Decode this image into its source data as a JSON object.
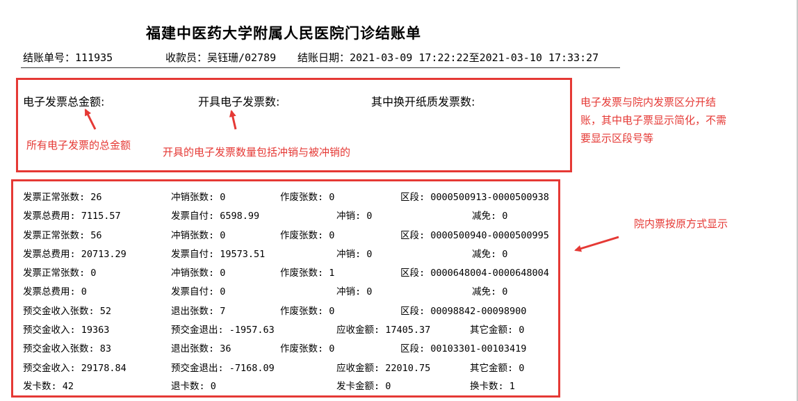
{
  "title": "福建中医药大学附属人民医院门诊结账单",
  "header": {
    "bill_no": "结账单号：111935",
    "cashier": "收款员：吴钰珊/02789",
    "date_range": "结账日期：2021-03-09 17:22:22至2021-03-10 17:33:27"
  },
  "electronic": {
    "total_amount_label": "电子发票总金额:",
    "count_label": "开具电子发票数:",
    "paper_label": "其中换开纸质发票数:"
  },
  "annotations": {
    "total_note": "所有电子发票的总金额",
    "count_note": "开具的电子发票数量包括冲销与被冲销的",
    "side_note_lines": [
      "电子发票与院内发票区分开结",
      "账，其中电子票显示简化，不需",
      "要显示区段号等"
    ],
    "inhouse_note": "院内票按原方式显示"
  },
  "rows": [
    [
      "发票正常张数: 26",
      "冲销张数: 0",
      "作废张数: 0",
      "区段: 0000500913-0000500938"
    ],
    [
      "发票总费用:  7115.57",
      "发票自付: 6598.99",
      "冲销:  0",
      "减免:  0"
    ],
    [
      "发票正常张数: 56",
      "冲销张数: 0",
      "作废张数: 0",
      "区段: 0000500940-0000500995"
    ],
    [
      "发票总费用:  20713.29",
      "发票自付: 19573.51",
      "冲销:  0",
      "减免:  0"
    ],
    [
      "发票正常张数: 0",
      "冲销张数: 0",
      "作废张数: 1",
      "区段: 0000648004-0000648004"
    ],
    [
      "发票总费用:  0",
      "发票自付: 0",
      "冲销:  0",
      "减免:  0"
    ],
    [
      "预交金收入张数: 52",
      "退出张数: 7",
      "作废张数: 0",
      "区段: 00098842-00098900"
    ],
    [
      "预交金收入: 19363",
      "预交金退出: -1957.63",
      "应收金额: 17405.37",
      "其它金额: 0"
    ],
    [
      "预交金收入张数: 83",
      "退出张数: 36",
      "作废张数: 0",
      "区段: 00103301-00103419"
    ],
    [
      "预交金收入: 29178.84",
      "预交金退出: -7168.09",
      "应收金额: 22010.75",
      "其它金额: 0"
    ],
    [
      "发卡数: 42",
      "退卡数: 0",
      "发卡金额: 0",
      "换卡数: 1"
    ]
  ],
  "colors": {
    "annotation": "#e53935"
  }
}
